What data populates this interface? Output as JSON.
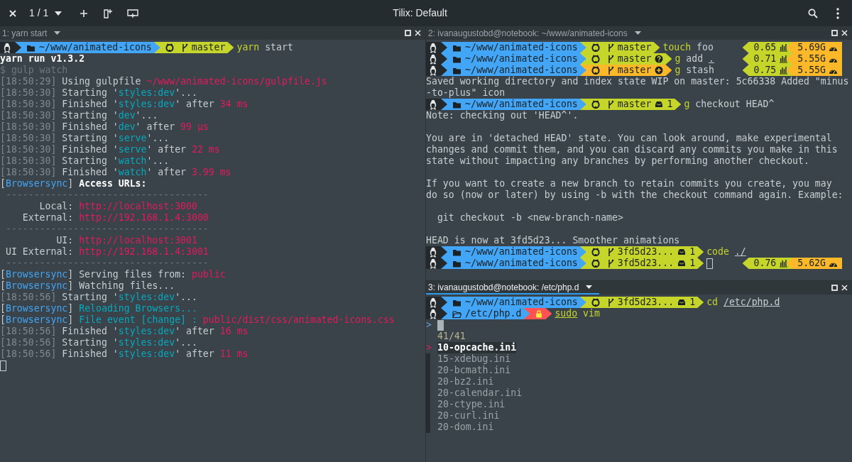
{
  "window": {
    "title": "Tilix: Default",
    "session": "1 / 1"
  },
  "panes": [
    {
      "title": "1: yarn start",
      "active": false,
      "lines": [
        {
          "kind": "prompt",
          "segments": [
            {
              "kind": "os"
            },
            {
              "kind": "dir",
              "text": "~/www/animated-icons",
              "color": "#42a5f5"
            },
            {
              "kind": "git",
              "text": "master",
              "color": "#c6d52a",
              "untracked": false,
              "staged": false,
              "stashed": false
            }
          ],
          "command": [
            {
              "text": "yarn",
              "kind": "command"
            },
            {
              "text": " start",
              "kind": "argument"
            }
          ]
        },
        {
          "kind": "text",
          "spans": [
            {
              "text": "yarn run v1.3.2",
              "kind": "heading"
            }
          ]
        },
        {
          "kind": "text",
          "spans": [
            {
              "text": "$ gulp watch",
              "kind": "comment"
            }
          ]
        },
        {
          "kind": "text",
          "spans": [
            {
              "text": "[18:50:29]",
              "kind": "timestamp"
            },
            {
              "text": " Using gulpfile ",
              "kind": "text"
            },
            {
              "text": "~/www/animated-icons/gulpfile.js",
              "kind": "value"
            }
          ]
        },
        {
          "kind": "text",
          "spans": [
            {
              "text": "[18:50:30]",
              "kind": "timestamp"
            },
            {
              "text": " Starting '",
              "kind": "text"
            },
            {
              "text": "styles:dev",
              "kind": "event"
            },
            {
              "text": "'...",
              "kind": "text"
            }
          ]
        },
        {
          "kind": "text",
          "spans": [
            {
              "text": "[18:50:30]",
              "kind": "timestamp"
            },
            {
              "text": " Finished '",
              "kind": "text"
            },
            {
              "text": "styles:dev",
              "kind": "event"
            },
            {
              "text": "' after ",
              "kind": "text"
            },
            {
              "text": "34 ms",
              "kind": "value"
            }
          ]
        },
        {
          "kind": "text",
          "spans": [
            {
              "text": "[18:50:30]",
              "kind": "timestamp"
            },
            {
              "text": " Starting '",
              "kind": "text"
            },
            {
              "text": "dev",
              "kind": "event"
            },
            {
              "text": "'...",
              "kind": "text"
            }
          ]
        },
        {
          "kind": "text",
          "spans": [
            {
              "text": "[18:50:30]",
              "kind": "timestamp"
            },
            {
              "text": " Finished '",
              "kind": "text"
            },
            {
              "text": "dev",
              "kind": "event"
            },
            {
              "text": "' after ",
              "kind": "text"
            },
            {
              "text": "99 μs",
              "kind": "value"
            }
          ]
        },
        {
          "kind": "text",
          "spans": [
            {
              "text": "[18:50:30]",
              "kind": "timestamp"
            },
            {
              "text": " Starting '",
              "kind": "text"
            },
            {
              "text": "serve",
              "kind": "event"
            },
            {
              "text": "'...",
              "kind": "text"
            }
          ]
        },
        {
          "kind": "text",
          "spans": [
            {
              "text": "[18:50:30]",
              "kind": "timestamp"
            },
            {
              "text": " Finished '",
              "kind": "text"
            },
            {
              "text": "serve",
              "kind": "event"
            },
            {
              "text": "' after ",
              "kind": "text"
            },
            {
              "text": "22 ms",
              "kind": "value"
            }
          ]
        },
        {
          "kind": "text",
          "spans": [
            {
              "text": "[18:50:30]",
              "kind": "timestamp"
            },
            {
              "text": " Starting '",
              "kind": "text"
            },
            {
              "text": "watch",
              "kind": "event"
            },
            {
              "text": "'...",
              "kind": "text"
            }
          ]
        },
        {
          "kind": "text",
          "spans": [
            {
              "text": "[18:50:30]",
              "kind": "timestamp"
            },
            {
              "text": " Finished '",
              "kind": "text"
            },
            {
              "text": "watch",
              "kind": "event"
            },
            {
              "text": "' after ",
              "kind": "text"
            },
            {
              "text": "3.99 ms",
              "kind": "value"
            }
          ]
        },
        {
          "kind": "text",
          "spans": [
            {
              "text": "[",
              "kind": "text"
            },
            {
              "text": "Browsersync",
              "kind": "source"
            },
            {
              "text": "] ",
              "kind": "text"
            },
            {
              "text": "Access URLs:",
              "kind": "heading"
            }
          ]
        },
        {
          "kind": "text",
          "spans": [
            {
              "text": " ------------------------------------",
              "kind": "comment"
            }
          ]
        },
        {
          "kind": "text",
          "spans": [
            {
              "text": "       Local: ",
              "kind": "text"
            },
            {
              "text": "http://localhost:3000",
              "kind": "value"
            }
          ]
        },
        {
          "kind": "text",
          "spans": [
            {
              "text": "    External: ",
              "kind": "text"
            },
            {
              "text": "http://192.168.1.4:3000",
              "kind": "value"
            }
          ]
        },
        {
          "kind": "text",
          "spans": [
            {
              "text": " ------------------------------------",
              "kind": "comment"
            }
          ]
        },
        {
          "kind": "text",
          "spans": [
            {
              "text": "          UI: ",
              "kind": "text"
            },
            {
              "text": "http://localhost:3001",
              "kind": "value"
            }
          ]
        },
        {
          "kind": "text",
          "spans": [
            {
              "text": " UI External: ",
              "kind": "text"
            },
            {
              "text": "http://192.168.1.4:3001",
              "kind": "value"
            }
          ]
        },
        {
          "kind": "text",
          "spans": [
            {
              "text": " ------------------------------------",
              "kind": "comment"
            }
          ]
        },
        {
          "kind": "text",
          "spans": [
            {
              "text": "[",
              "kind": "text"
            },
            {
              "text": "Browsersync",
              "kind": "source"
            },
            {
              "text": "] Serving files from: ",
              "kind": "text"
            },
            {
              "text": "public",
              "kind": "value"
            }
          ]
        },
        {
          "kind": "text",
          "spans": [
            {
              "text": "[",
              "kind": "text"
            },
            {
              "text": "Browsersync",
              "kind": "source"
            },
            {
              "text": "] Watching files...",
              "kind": "text"
            }
          ]
        },
        {
          "kind": "text",
          "spans": [
            {
              "text": "[18:50:56]",
              "kind": "timestamp"
            },
            {
              "text": " Starting '",
              "kind": "text"
            },
            {
              "text": "styles:dev",
              "kind": "event"
            },
            {
              "text": "'...",
              "kind": "text"
            }
          ]
        },
        {
          "kind": "text",
          "spans": [
            {
              "text": "[",
              "kind": "text"
            },
            {
              "text": "Browsersync",
              "kind": "source"
            },
            {
              "text": "] ",
              "kind": "text"
            },
            {
              "text": "Reloading Browsers...",
              "kind": "event"
            }
          ]
        },
        {
          "kind": "text",
          "spans": [
            {
              "text": "[",
              "kind": "text"
            },
            {
              "text": "Browsersync",
              "kind": "source"
            },
            {
              "text": "] ",
              "kind": "text"
            },
            {
              "text": "File event [change] : ",
              "kind": "event"
            },
            {
              "text": "public/dist/css/animated-icons.css",
              "kind": "value"
            }
          ]
        },
        {
          "kind": "text",
          "spans": [
            {
              "text": "[18:50:56]",
              "kind": "timestamp"
            },
            {
              "text": " Finished '",
              "kind": "text"
            },
            {
              "text": "styles:dev",
              "kind": "event"
            },
            {
              "text": "' after ",
              "kind": "text"
            },
            {
              "text": "16 ms",
              "kind": "value"
            }
          ]
        },
        {
          "kind": "text",
          "spans": [
            {
              "text": "[18:50:56]",
              "kind": "timestamp"
            },
            {
              "text": " Starting '",
              "kind": "text"
            },
            {
              "text": "styles:dev",
              "kind": "event"
            },
            {
              "text": "'...",
              "kind": "text"
            }
          ]
        },
        {
          "kind": "text",
          "spans": [
            {
              "text": "[18:50:56]",
              "kind": "timestamp"
            },
            {
              "text": " Finished '",
              "kind": "text"
            },
            {
              "text": "styles:dev",
              "kind": "event"
            },
            {
              "text": "' after ",
              "kind": "text"
            },
            {
              "text": "11 ms",
              "kind": "value"
            }
          ]
        },
        {
          "kind": "text",
          "cursor": true
        }
      ]
    },
    {
      "title": "2: ivanaugustobd@notebook: ~/www/animated-icons",
      "active": false,
      "lines": [
        {
          "kind": "prompt",
          "segments": [
            {
              "kind": "os"
            },
            {
              "kind": "dir",
              "text": "~/www/animated-icons",
              "color": "#42a5f5"
            },
            {
              "kind": "git",
              "text": "master",
              "color": "#c6d52a",
              "untracked": false,
              "staged": false,
              "stashed": false
            }
          ],
          "command": [
            {
              "text": "touch",
              "kind": "command"
            },
            {
              "text": " foo",
              "kind": "argument"
            }
          ],
          "right": [
            {
              "kind": "load",
              "text": "0.65",
              "color": "#c6d52a"
            },
            {
              "kind": "memory",
              "text": "5.69G",
              "color": "#fbb829"
            }
          ]
        },
        {
          "kind": "prompt",
          "segments": [
            {
              "kind": "os"
            },
            {
              "kind": "dir",
              "text": "~/www/animated-icons",
              "color": "#42a5f5"
            },
            {
              "kind": "git",
              "text": "master",
              "color": "#c6d52a",
              "untracked": true,
              "staged": false,
              "stashed": false
            }
          ],
          "command": [
            {
              "text": "g",
              "kind": "command"
            },
            {
              "text": " add ",
              "kind": "argument"
            },
            {
              "text": ".",
              "kind": "path"
            }
          ],
          "right": [
            {
              "kind": "load",
              "text": "0.71",
              "color": "#c6d52a"
            },
            {
              "kind": "memory",
              "text": "5.55G",
              "color": "#fbb829"
            }
          ]
        },
        {
          "kind": "prompt",
          "segments": [
            {
              "kind": "os"
            },
            {
              "kind": "dir",
              "text": "~/www/animated-icons",
              "color": "#42a5f5"
            },
            {
              "kind": "git",
              "text": "master",
              "color": "#fbb829",
              "untracked": false,
              "staged": true,
              "stashed": false
            }
          ],
          "command": [
            {
              "text": "g",
              "kind": "command"
            },
            {
              "text": " stash",
              "kind": "argument"
            }
          ],
          "right": [
            {
              "kind": "load",
              "text": "0.75",
              "color": "#c6d52a"
            },
            {
              "kind": "memory",
              "text": "5.55G",
              "color": "#fbb829"
            }
          ]
        },
        {
          "kind": "text",
          "spans": [
            {
              "text": "Saved working directory and index state WIP on master: 5c66338 Added \"minus",
              "kind": "text"
            }
          ]
        },
        {
          "kind": "text",
          "spans": [
            {
              "text": "-to-plus\" icon",
              "kind": "text"
            }
          ]
        },
        {
          "kind": "prompt",
          "segments": [
            {
              "kind": "os"
            },
            {
              "kind": "dir",
              "text": "~/www/animated-icons",
              "color": "#42a5f5"
            },
            {
              "kind": "git",
              "text": "master",
              "color": "#c6d52a",
              "untracked": false,
              "staged": false,
              "stashed": true,
              "count": "1"
            }
          ],
          "command": [
            {
              "text": "g",
              "kind": "command"
            },
            {
              "text": " checkout HEAD^",
              "kind": "argument"
            }
          ]
        },
        {
          "kind": "text",
          "spans": [
            {
              "text": "Note: checking out 'HEAD^'.",
              "kind": "text"
            }
          ]
        },
        {
          "kind": "blank"
        },
        {
          "kind": "text",
          "spans": [
            {
              "text": "You are in 'detached HEAD' state. You can look around, make experimental",
              "kind": "text"
            }
          ]
        },
        {
          "kind": "text",
          "spans": [
            {
              "text": "changes and commit them, and you can discard any commits you make in this",
              "kind": "text"
            }
          ]
        },
        {
          "kind": "text",
          "spans": [
            {
              "text": "state without impacting any branches by performing another checkout.",
              "kind": "text"
            }
          ]
        },
        {
          "kind": "blank"
        },
        {
          "kind": "text",
          "spans": [
            {
              "text": "If you want to create a new branch to retain commits you create, you may",
              "kind": "text"
            }
          ]
        },
        {
          "kind": "text",
          "spans": [
            {
              "text": "do so (now or later) by using -b with the checkout command again. Example:",
              "kind": "text"
            }
          ]
        },
        {
          "kind": "blank"
        },
        {
          "kind": "text",
          "spans": [
            {
              "text": "  git checkout -b <new-branch-name>",
              "kind": "text"
            }
          ]
        },
        {
          "kind": "blank"
        },
        {
          "kind": "text",
          "spans": [
            {
              "text": "HEAD is now at 3fd5d23... Smoother animations",
              "kind": "text"
            }
          ]
        },
        {
          "kind": "prompt",
          "segments": [
            {
              "kind": "os"
            },
            {
              "kind": "dir",
              "text": "~/www/animated-icons",
              "color": "#42a5f5"
            },
            {
              "kind": "git",
              "text": "3fd5d23...",
              "color": "#c6d52a",
              "untracked": false,
              "staged": false,
              "stashed": true,
              "count": "1"
            }
          ],
          "command": [
            {
              "text": "code ",
              "kind": "command"
            },
            {
              "text": "./",
              "kind": "path"
            }
          ]
        },
        {
          "kind": "prompt",
          "segments": [
            {
              "kind": "os"
            },
            {
              "kind": "dir",
              "text": "~/www/animated-icons",
              "color": "#42a5f5"
            },
            {
              "kind": "git",
              "text": "3fd5d23...",
              "color": "#c6d52a",
              "untracked": false,
              "staged": false,
              "stashed": true,
              "count": "1"
            }
          ],
          "cursor": true,
          "right": [
            {
              "kind": "load",
              "text": "0.76",
              "color": "#c6d52a"
            },
            {
              "kind": "memory",
              "text": "5.62G",
              "color": "#fbb829"
            }
          ]
        }
      ]
    },
    {
      "title": "3: ivanaugustobd@notebook: /etc/php.d",
      "active": true,
      "lines": [
        {
          "kind": "prompt",
          "segments": [
            {
              "kind": "os"
            },
            {
              "kind": "dir",
              "text": "~/www/animated-icons",
              "color": "#42a5f5"
            },
            {
              "kind": "git",
              "text": "3fd5d23...",
              "color": "#c6d52a",
              "untracked": false,
              "staged": false,
              "stashed": true,
              "count": "1"
            }
          ],
          "command": [
            {
              "text": "cd ",
              "kind": "command"
            },
            {
              "text": "/etc/php.d",
              "kind": "path"
            }
          ]
        },
        {
          "kind": "prompt",
          "segments": [
            {
              "kind": "os"
            },
            {
              "kind": "dir",
              "text": "/etc/php.d",
              "color": "#42a5f5"
            },
            {
              "kind": "lock",
              "color": "#ff5252"
            }
          ],
          "command": [
            {
              "text": "sudo",
              "kind": "command_path"
            },
            {
              "text": " vim",
              "kind": "command"
            }
          ]
        },
        {
          "kind": "text",
          "spans": [
            {
              "text": ">",
              "kind": "prompt"
            }
          ],
          "cursor": true
        },
        {
          "kind": "fzf_info",
          "text": "41/41"
        },
        {
          "kind": "fzf_item",
          "text": "10-opcache.ini",
          "selected": true,
          "marker": ">"
        },
        {
          "kind": "fzf_item",
          "text": "15-xdebug.ini",
          "selected": false
        },
        {
          "kind": "fzf_item",
          "text": "20-bcmath.ini",
          "selected": false
        },
        {
          "kind": "fzf_item",
          "text": "20-bz2.ini",
          "selected": false
        },
        {
          "kind": "fzf_item",
          "text": "20-calendar.ini",
          "selected": false
        },
        {
          "kind": "fzf_item",
          "text": "20-ctype.ini",
          "selected": false
        },
        {
          "kind": "fzf_item",
          "text": "20-curl.ini",
          "selected": false
        },
        {
          "kind": "fzf_item",
          "text": "20-dom.ini",
          "selected": false
        }
      ]
    }
  ]
}
